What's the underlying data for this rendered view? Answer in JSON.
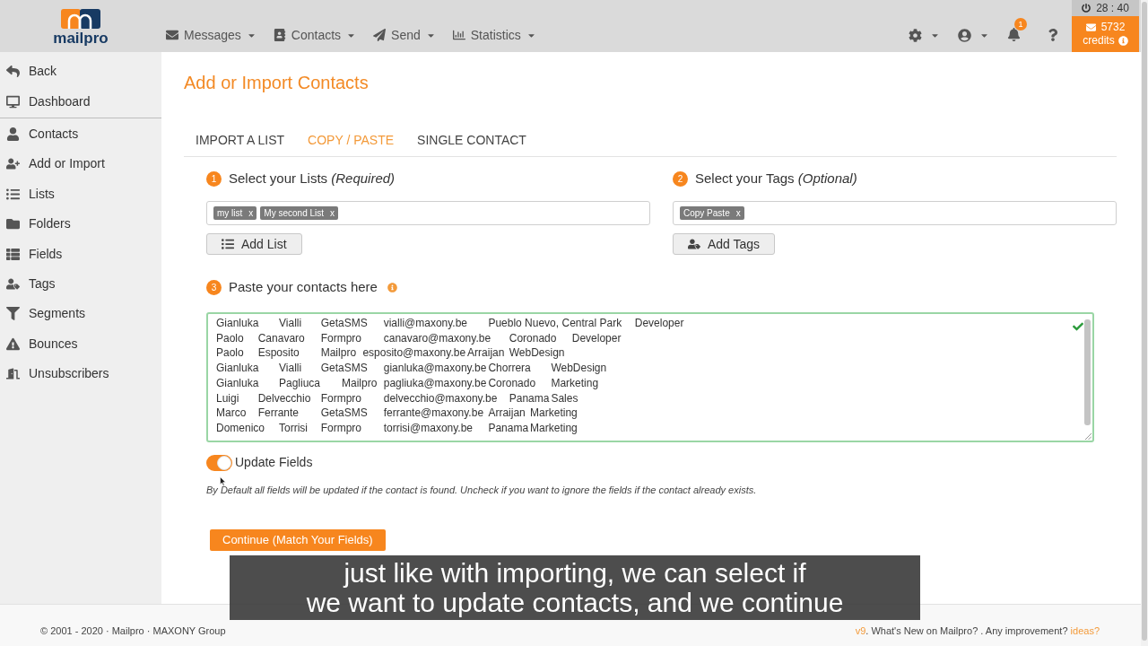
{
  "header": {
    "logo_text": "mailpro",
    "nav": [
      {
        "label": "Messages"
      },
      {
        "label": "Contacts"
      },
      {
        "label": "Send"
      },
      {
        "label": "Statistics"
      }
    ],
    "notification_count": "1",
    "timer": "28 : 40",
    "credits": {
      "count": "5732",
      "label": "credits"
    }
  },
  "sidebar": {
    "top_items": [
      {
        "label": "Back"
      },
      {
        "label": "Dashboard"
      }
    ],
    "items": [
      {
        "label": "Contacts"
      },
      {
        "label": "Add or Import"
      },
      {
        "label": "Lists"
      },
      {
        "label": "Folders"
      },
      {
        "label": "Fields"
      },
      {
        "label": "Tags"
      },
      {
        "label": "Segments"
      },
      {
        "label": "Bounces"
      },
      {
        "label": "Unsubscribers"
      }
    ]
  },
  "page": {
    "title": "Add or Import Contacts",
    "tabs": [
      {
        "label": "IMPORT A LIST",
        "selected": false
      },
      {
        "label": "COPY / PASTE",
        "selected": true
      },
      {
        "label": "SINGLE CONTACT",
        "selected": false
      }
    ],
    "lists": {
      "step": "1",
      "label": "Select your Lists *(Required)*",
      "tags": [
        {
          "label": "my list",
          "remove": "x"
        },
        {
          "label": "My second List",
          "remove": "x"
        }
      ],
      "button": "Add List"
    },
    "tags": {
      "step": "2",
      "label": "Select your Tags *(Optional)*",
      "tags": [
        {
          "label": "Copy Paste",
          "remove": "x"
        }
      ],
      "button": "Add Tags"
    },
    "paste": {
      "step": "3",
      "label": "Paste your contacts here",
      "valid": true,
      "lines": [
        "Gianluka\tVialli\tGetaSMS\tvialli@maxony.be\tPueblo Nuevo, Central Park\tDeveloper",
        "Paolo\tCanavaro\tFormpro\tcanavaro@maxony.be\tCoronado\tDeveloper",
        "Paolo\tEsposito\tMailpro\tesposito@maxony.be\tArraijan\tWebDesign",
        "Gianluka\tVialli\tGetaSMS\tgianluka@maxony.be\tChorrera\tWebDesign",
        "Gianluka\tPagliuca\tMailpro\tpagliuka@maxony.be\tCoronado\tMarketing",
        "Luigi\tDelvecchio\tFormpro\tdelvecchio@maxony.be\tPanama\tSales",
        "Marco\tFerrante\tGetaSMS\tferrante@maxony.be\tArraijan\tMarketing",
        "Domenico\tTorrisi\tFormpro\ttorrisi@maxony.be\tPanama\tMarketing"
      ]
    },
    "update_fields": {
      "on": true,
      "label": "Update Fields",
      "hint": "By Default all fields will be updated if the contact is found. Uncheck if you want to ignore the fields if the contact already exists."
    },
    "continue_button": "Continue (Match Your Fields)"
  },
  "subtitle": {
    "lines": [
      "just like with importing, we can select if",
      "we want to update contacts, and we continue"
    ]
  },
  "footer": {
    "copyright": "© 2001 - 2020 · Mailpro · MAXONY Group",
    "version_link": "v9",
    "text": ". What's New on Mailpro? . Any improvement?",
    "ideas_link": "ideas?"
  }
}
